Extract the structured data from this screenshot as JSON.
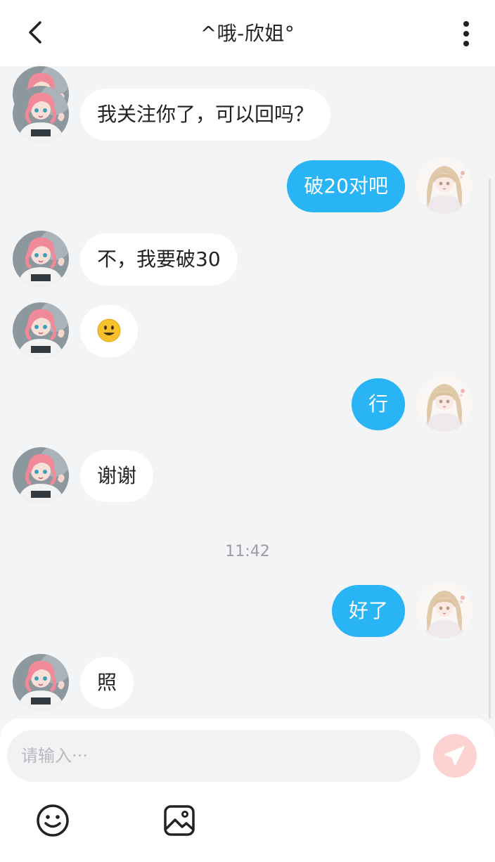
{
  "header": {
    "title": "^哦-欣姐°",
    "back_icon": "chevron-left-icon",
    "more_icon": "more-vertical-icon"
  },
  "messages": [
    {
      "side": "in",
      "text": "我关注你了，可以回吗？"
    },
    {
      "side": "out",
      "text": "破20对吧"
    },
    {
      "side": "in",
      "text": "不，我要破30"
    },
    {
      "side": "in",
      "emoji": "smile-emoji-icon"
    },
    {
      "side": "out",
      "text": "行"
    },
    {
      "side": "in",
      "text": "谢谢"
    },
    {
      "side": "out",
      "text": "好了"
    },
    {
      "side": "in",
      "text": "照"
    }
  ],
  "timestamp": "11:42",
  "composer": {
    "placeholder": "请输入···",
    "send_icon": "send-paper-plane-icon",
    "send_color": "#fcd3d1",
    "tools": [
      "emoji-icon",
      "image-icon"
    ]
  },
  "colors": {
    "outgoing_bubble": "#29b4f5",
    "incoming_bubble": "#ffffff",
    "background": "#f3f4f6"
  }
}
